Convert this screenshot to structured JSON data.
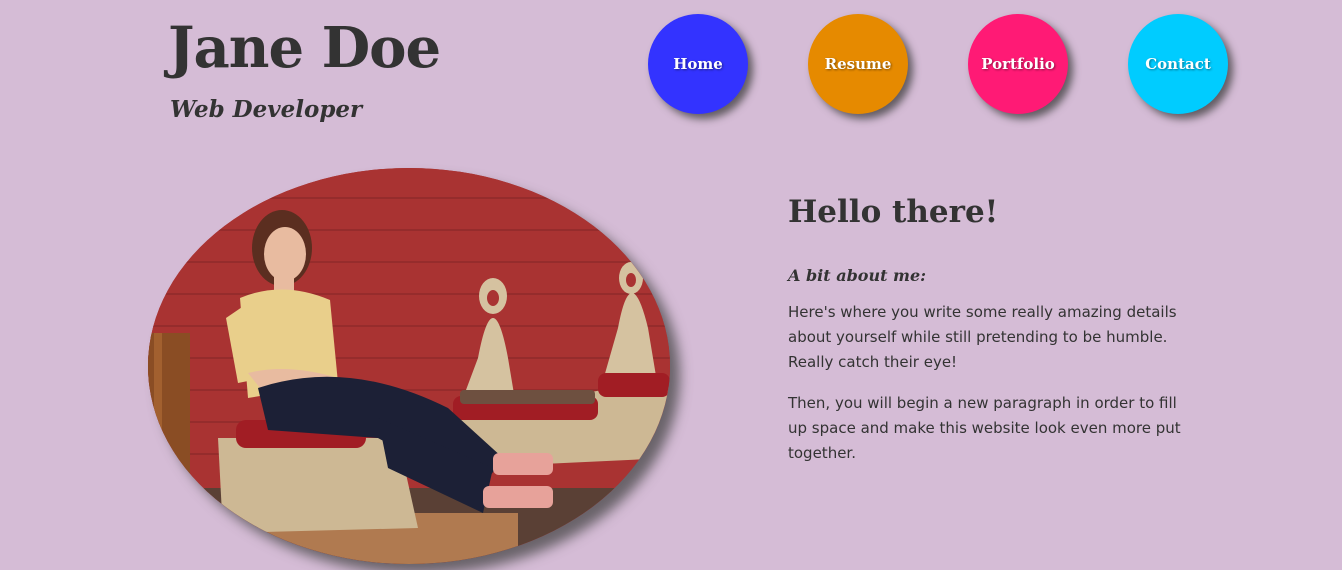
{
  "header": {
    "name": "Jane Doe",
    "role": "Web Developer"
  },
  "nav": {
    "items": [
      {
        "label": "Home",
        "color": "#3333ff"
      },
      {
        "label": "Resume",
        "color": "#e68a00"
      },
      {
        "label": "Portfolio",
        "color": "#ff1a75"
      },
      {
        "label": "Contact",
        "color": "#00ccff"
      }
    ]
  },
  "about": {
    "greeting": "Hello there!",
    "heading": "A bit about me:",
    "paragraphs": [
      "Here's where you write some really amazing details about yourself while still pretending to be humble. Really catch their eye!",
      "Then, you will begin a new paragraph in order to fill up space and make this website look even more put together."
    ]
  },
  "colors": {
    "background": "#d5bcd6",
    "text": "#333333"
  }
}
